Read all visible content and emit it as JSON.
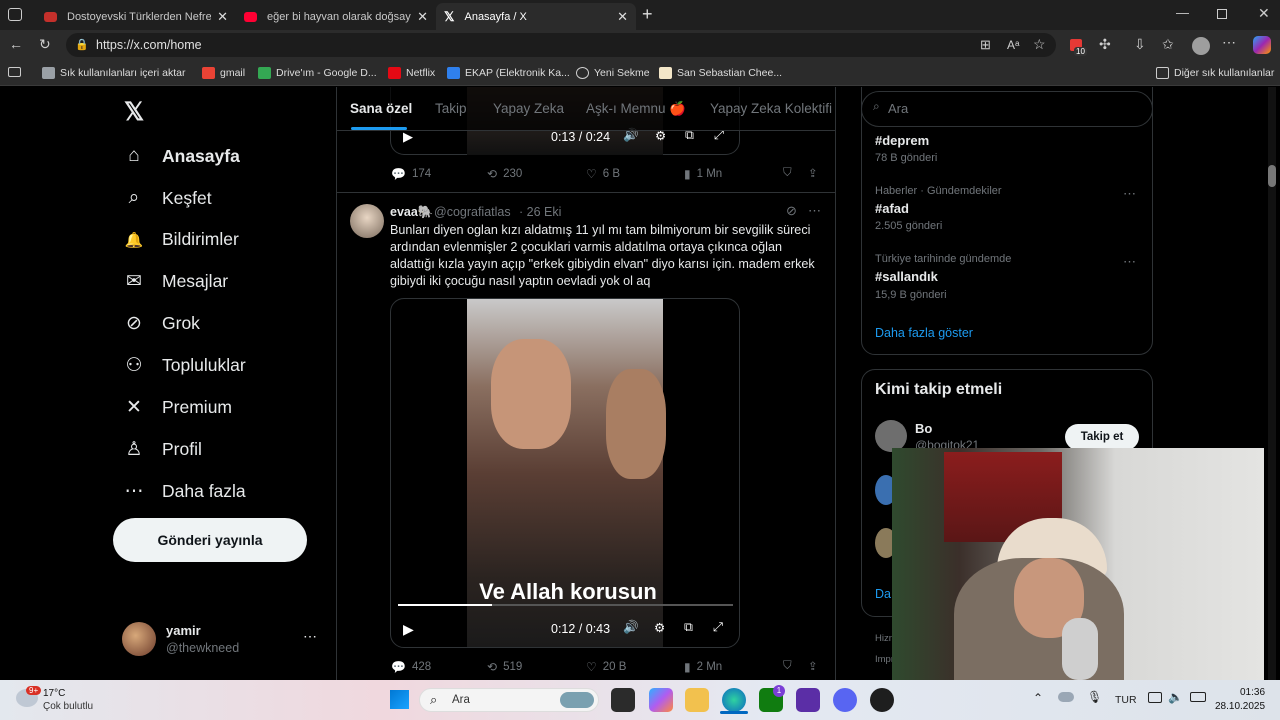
{
  "browser": {
    "tabs": [
      {
        "title": "Dostoyevski Türklerden Nefret Ed",
        "favicon_color": "#c4302b"
      },
      {
        "title": "eğer bi hayvan olarak doğsaydın",
        "favicon_color": "#ff0033"
      },
      {
        "title": "Anasayfa / X",
        "favicon_color": "#ffffff"
      }
    ],
    "url": "https://x.com/home",
    "extension_badge": "10",
    "bookmarks": [
      {
        "label": "Sık kullanılanları içeri aktar",
        "icon": "import-icon",
        "color": "#9aa0a6"
      },
      {
        "label": "gmail",
        "icon": "gmail-icon",
        "color": "#ea4335"
      },
      {
        "label": "Drive'ım - Google D...",
        "icon": "drive-icon",
        "color": "#34a853"
      },
      {
        "label": "Netflix",
        "icon": "netflix-icon",
        "color": "#e50914"
      },
      {
        "label": "EKAP (Elektronik Ka...",
        "icon": "ekap-icon",
        "color": "#2f80ed"
      },
      {
        "label": "Yeni Sekme",
        "icon": "globe-icon",
        "color": "#cfcfcf"
      },
      {
        "label": "San Sebastian Chee...",
        "icon": "recipe-icon",
        "color": "#f3e6c8"
      }
    ],
    "other_favorites": "Diğer sık kullanılanlar"
  },
  "sidebar": {
    "items": [
      {
        "label": "Anasayfa",
        "icon": "home-icon",
        "glyph": "⌂"
      },
      {
        "label": "Keşfet",
        "icon": "search-icon",
        "glyph": "⌕"
      },
      {
        "label": "Bildirimler",
        "icon": "bell-icon",
        "glyph": "🔔"
      },
      {
        "label": "Mesajlar",
        "icon": "mail-icon",
        "glyph": "✉"
      },
      {
        "label": "Grok",
        "icon": "grok-icon",
        "glyph": "⊘"
      },
      {
        "label": "Topluluklar",
        "icon": "communities-icon",
        "glyph": "⚇"
      },
      {
        "label": "Premium",
        "icon": "x-logo-icon",
        "glyph": "✕"
      },
      {
        "label": "Profil",
        "icon": "person-icon",
        "glyph": "♙"
      },
      {
        "label": "Daha fazla",
        "icon": "more-circle-icon",
        "glyph": "⋯"
      }
    ],
    "post_button": "Gönderi yayınla",
    "account": {
      "name": "yamir",
      "handle": "@thewkneed"
    }
  },
  "feed": {
    "tabs": [
      "Sana özel",
      "Takip",
      "Yapay Zeka",
      "Aşk-ı Memnu 🍎",
      "Yapay Zeka Kolektifi"
    ],
    "prev_post": {
      "video_time": "0:13 / 0:24",
      "replies": "174",
      "reposts": "230",
      "likes": "6 B",
      "views": "1 Mn"
    },
    "post": {
      "name": "evaa🐘",
      "handle": "@cografiatlas",
      "date": "· 26 Eki",
      "text": "Bunları diyen oglan kızı aldatmış 11 yıl mı tam bilmiyorum bir sevgilik süreci ardından evlenmişler 2 çocuklari varmis aldatılma ortaya çıkınca oğlan aldattığı kızla yayın açıp \"erkek gibiydin elvan\" diyo karısı için. madem erkek gibiydi iki çocuğu nasıl yaptın oevladi yok ol aq",
      "caption": "Ve Allah korusun",
      "video_time": "0:12 / 0:43",
      "progress": 0.28,
      "replies": "428",
      "reposts": "519",
      "likes": "20 B",
      "views": "2 Mn"
    }
  },
  "right": {
    "search_placeholder": "Ara",
    "trends": [
      {
        "context": "",
        "tag": "#deprem",
        "count": "78 B gönderi"
      },
      {
        "context": "Haberler · Gündemdekiler",
        "tag": "#afad",
        "count": "2.505 gönderi"
      },
      {
        "context": "Türkiye tarihinde gündemde",
        "tag": "#sallandık",
        "count": "15,9 B gönderi"
      }
    ],
    "show_more": "Daha fazla göster",
    "who_to_follow": {
      "title": "Kimi takip etmeli",
      "user": {
        "name": "Bo",
        "handle": "@bogitok21"
      },
      "follow_label": "Takip et",
      "partial_link": "Da",
      "footer_partial": [
        "Hizm",
        "Impr"
      ]
    }
  },
  "taskbar": {
    "weather_temp": "17°C",
    "weather_desc": "Çok bulutlu",
    "weather_badge": "9+",
    "search": "Ara",
    "lang": "TUR",
    "time": "01:36",
    "date": "28.10.2025"
  }
}
